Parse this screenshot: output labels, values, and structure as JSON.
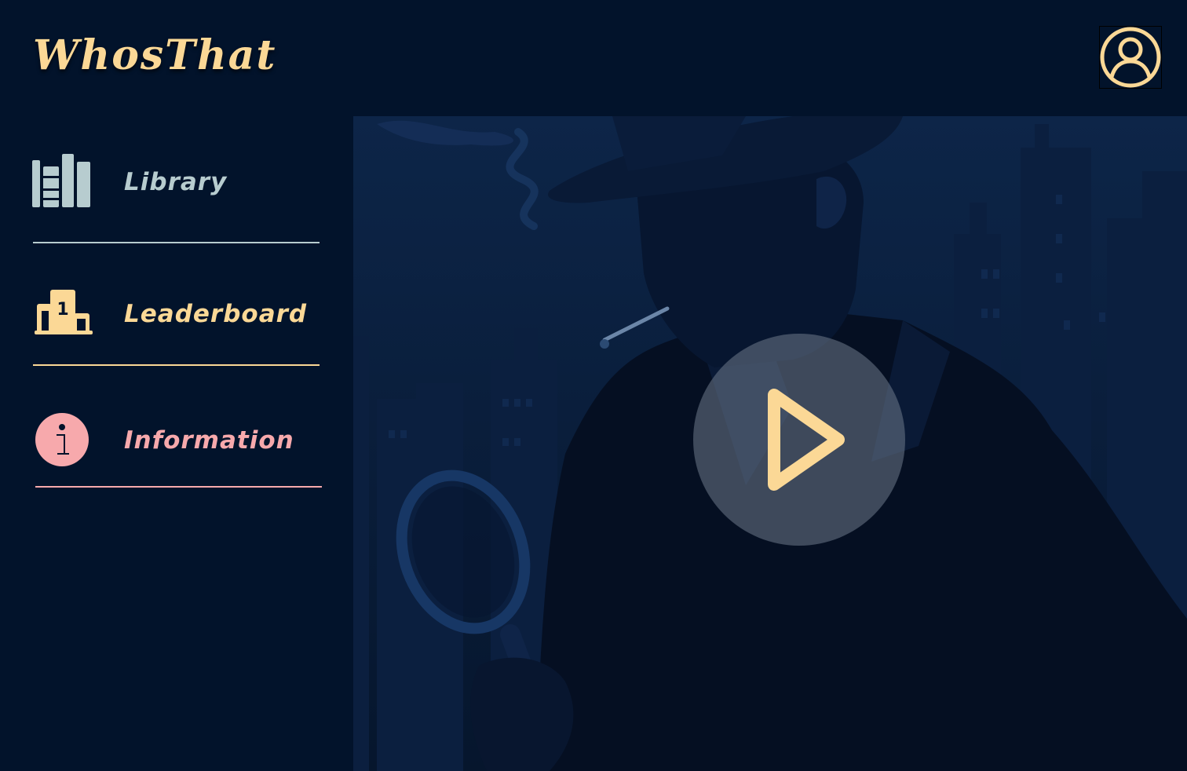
{
  "app": {
    "brand": "WhosThat"
  },
  "header": {
    "profile_icon": "user-circle-icon"
  },
  "nav": {
    "items": [
      {
        "label": "Library",
        "icon": "books-icon",
        "color": "#b7cccf"
      },
      {
        "label": "Leaderboard",
        "icon": "podium-icon",
        "color": "#fbd896"
      },
      {
        "label": "Information",
        "icon": "info-icon",
        "color": "#f7a9ac"
      }
    ]
  },
  "hero": {
    "image": "detective-silhouette-illustration",
    "play_icon": "play-icon"
  },
  "colors": {
    "background": "#02132b",
    "accent_gold": "#fbd896",
    "library": "#b7cccf",
    "info_pink": "#f7a9ac"
  }
}
